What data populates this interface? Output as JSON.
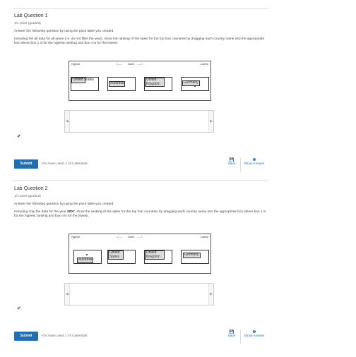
{
  "questions": [
    {
      "title": "Lab Question 1",
      "points": "1/1 point (graded)",
      "instruction": "Answer the following question by using the pivot table you created.",
      "text": "Including the all data for all years (i.e. do not filter the year), show the ranking of the sales for the top four countries by dragging each country name into the appropriate box where box 1 is for the highest ranking and box 4 is for the lowest.",
      "labels": {
        "high": "Highest",
        "left": "<-----",
        "sales": "Sales",
        "right": "----->",
        "low": "Lowest"
      },
      "chips": [
        "United States",
        "Australia",
        "United Kingdom",
        "Germany"
      ],
      "prev": "◀",
      "next": "▶",
      "check": "✔",
      "submit": "Submit",
      "attempts": "You have used 1 of 2 attempts",
      "save": "Save",
      "show_answer": "Show Answer"
    },
    {
      "title": "Lab Question 2",
      "points": "1/1 point (graded)",
      "instruction": "Answer the following question by using the pivot table you created.",
      "text_before": "Including only the data for the year ",
      "text_year": "2007",
      "text_after": ", show the ranking of the sales for the top four countries by dragging each country name into the appropriate box where box 1 is for the highest ranking and box 4 is for the lowest.",
      "labels": {
        "high": "Highest",
        "left": "<-----",
        "sales": "Sales",
        "right": "----->",
        "low": "Lowest"
      },
      "chips": [
        "Australia",
        "United States",
        "United Kingdom",
        "Germany"
      ],
      "prev": "◀",
      "next": "▶",
      "check": "✔",
      "submit": "Submit",
      "attempts": "You have used 1 of 2 attempts",
      "save": "Save",
      "show_answer": "Show Answer"
    }
  ],
  "icons": {
    "save": "floppy-disk-icon",
    "show_answer": "info-icon"
  },
  "colors": {
    "accent": "#1f6fb2",
    "check": "#1f8a1f"
  }
}
